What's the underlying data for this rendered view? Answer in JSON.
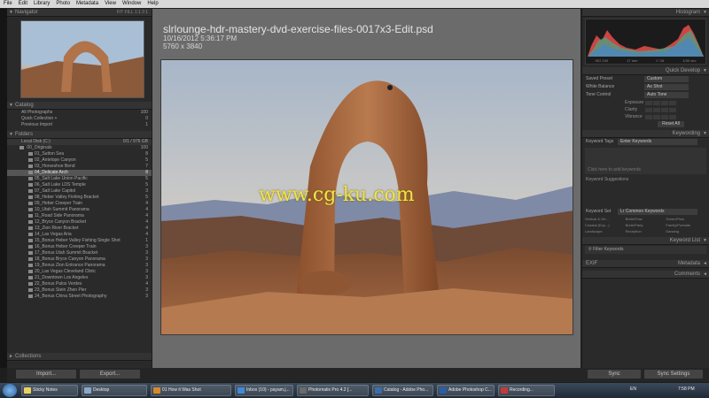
{
  "menu": [
    "File",
    "Edit",
    "Library",
    "Photo",
    "Metadata",
    "View",
    "Window",
    "Help"
  ],
  "left": {
    "navigator_title": "Navigator",
    "nav_zoom": "FIT  FILL  1:1  2:1",
    "catalog_title": "Catalog",
    "catalog_items": [
      {
        "label": "All Photographs",
        "count": "100"
      },
      {
        "label": "Quick Collection +",
        "count": "0"
      },
      {
        "label": "Previous Import",
        "count": "1"
      }
    ],
    "folders_title": "Folders",
    "drive_label": "Local Disk (C:)",
    "drive_space": "0/1 / 976 GB",
    "root_folder": {
      "label": "00_Originals",
      "count": "100"
    },
    "folders": [
      {
        "label": "01_Sutton Sea",
        "count": "8"
      },
      {
        "label": "02_Antelope Canyon",
        "count": "5"
      },
      {
        "label": "03_Horseshoe Bend",
        "count": "7"
      },
      {
        "label": "04_Delicate Arch",
        "count": "8"
      },
      {
        "label": "05_Salt Lake Union Pacific",
        "count": "5"
      },
      {
        "label": "06_Salt Lake LDS Temple",
        "count": "5"
      },
      {
        "label": "07_Salt Lake Capitol",
        "count": "3"
      },
      {
        "label": "08_Heber Valley Fishing Bracket",
        "count": "5"
      },
      {
        "label": "09_Heber Creeper Train",
        "count": "4"
      },
      {
        "label": "10_Utah Summit Panorama",
        "count": "4"
      },
      {
        "label": "11_Road Side Panorama",
        "count": "4"
      },
      {
        "label": "12_Bryce Canyon Bracket",
        "count": "4"
      },
      {
        "label": "13_Zion River Bracket",
        "count": "4"
      },
      {
        "label": "14_Las Vegas Aria",
        "count": "4"
      },
      {
        "label": "15_Bonus Heber Valley Fishing Single Shot",
        "count": "1"
      },
      {
        "label": "16_Bonus Heber Creeper Train",
        "count": "3"
      },
      {
        "label": "17_Bonus Utah Summit Bracket",
        "count": "3"
      },
      {
        "label": "18_Bonus Bryce Canyon Panorama",
        "count": "3"
      },
      {
        "label": "19_Bonus Zion Entrance Panorama",
        "count": "3"
      },
      {
        "label": "20_Las Vegas Cleveland Clinic",
        "count": "3"
      },
      {
        "label": "21_Downtown Los Angeles",
        "count": "3"
      },
      {
        "label": "22_Bonus Palos Verdes",
        "count": "4"
      },
      {
        "label": "23_Bonus Stein Zhen Pier",
        "count": "3"
      },
      {
        "label": "24_Bonus China Street Photography",
        "count": "3"
      }
    ],
    "selected_index": 3,
    "collections_title": "Collections",
    "import_label": "Import...",
    "export_label": "Export..."
  },
  "center": {
    "filename": "slrlounge-hdr-mastery-dvd-exercise-files-0017x3-Edit.psd",
    "datetime": "10/16/2012 5:36:17 PM",
    "dimensions": "5760 x 3840",
    "watermark": "www.cg-ku.com"
  },
  "right": {
    "histogram_title": "Histogram",
    "histo_stats": [
      "ISO 100",
      "17 mm",
      "f / 16",
      "1/30 sec"
    ],
    "quick_develop_title": "Quick Develop",
    "saved_preset_label": "Saved Preset",
    "saved_preset_value": "Custom",
    "white_balance_label": "White Balance",
    "white_balance_value": "As Shot",
    "tone_control_label": "Tone Control",
    "auto_tone_label": "Auto Tone",
    "tone_rows": [
      "Exposure",
      "Clarity",
      "Vibrance"
    ],
    "reset_all_label": "Reset All",
    "keywording_title": "Keywording",
    "keyword_tags_label": "Keyword Tags",
    "keyword_tags_value": "Enter Keywords",
    "click_keywords_placeholder": "Click here to add keywords",
    "keyword_suggestions_label": "Keyword Suggestions",
    "keyword_set_label": "Keyword Set",
    "keyword_set_value": "Lr Common Keywords",
    "keyword_set_items": [
      "Vertical & Ori...",
      "Bride/Flow",
      "Green/Flow",
      "Coastal (Exp...)",
      "Bride/Party",
      "Family/Portraits",
      "Landscape",
      "Reception",
      "Dancing"
    ],
    "keyword_list_title": "Keyword List",
    "filter_keywords_label": "Filter Keywords",
    "metadata_title": "Metadata",
    "metadata_preset": "EXIF",
    "comments_title": "Comments",
    "sync_label": "Sync",
    "sync_settings_label": "Sync Settings"
  },
  "taskbar": {
    "items": [
      {
        "label": "Sticky Notes",
        "color": "#e8d45a"
      },
      {
        "label": "Desktop",
        "color": "#8aa6c8"
      },
      {
        "label": "01 How it Was Shot",
        "color": "#d48a2a"
      },
      {
        "label": "Inbox (10) - payam.j...",
        "color": "#3f8ad8"
      },
      {
        "label": "Photomatix Pro 4.2 [...",
        "color": "#6a6a6a"
      },
      {
        "label": "Catalog - Adobe Pho...",
        "color": "#3a6ea8"
      },
      {
        "label": "Adobe Photoshop C...",
        "color": "#2a5fa8"
      },
      {
        "label": "Recording...",
        "color": "#c23a3a"
      }
    ],
    "lang": "EN",
    "time": "7:58 PM"
  }
}
